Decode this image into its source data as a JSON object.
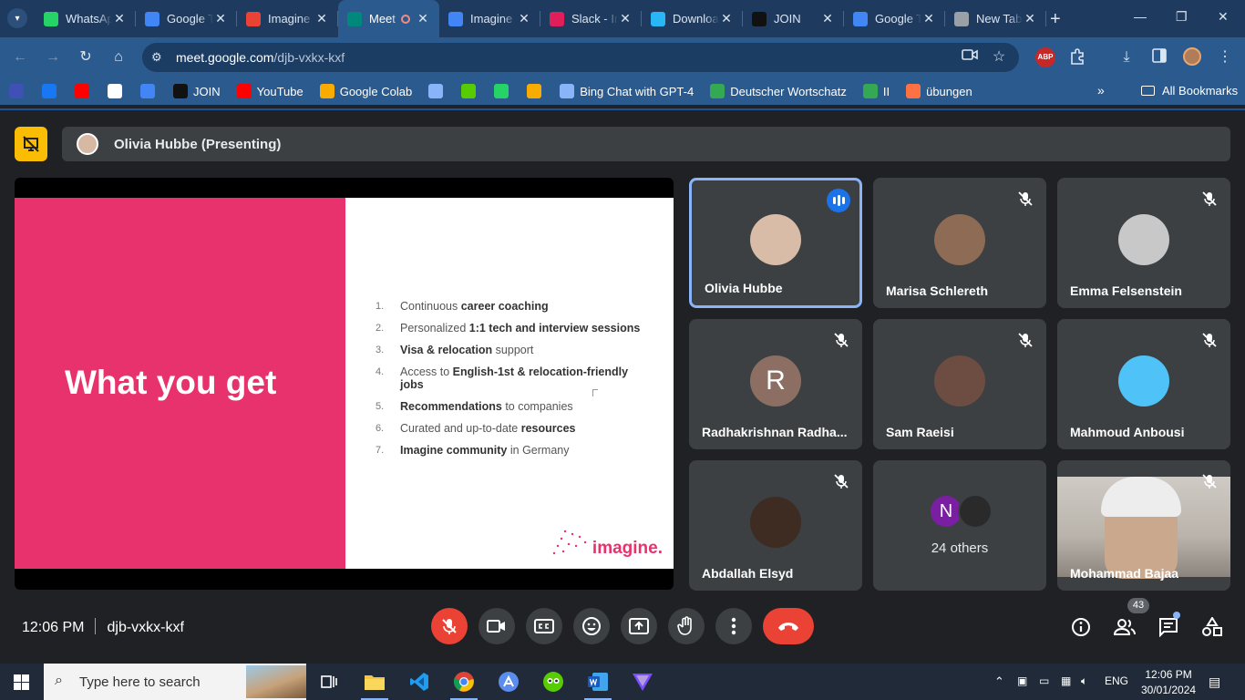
{
  "browser": {
    "tabs": [
      {
        "title": "WhatsApp",
        "favicon": "whatsapp-icon",
        "color": "#25d366"
      },
      {
        "title": "Google Translate",
        "favicon": "google-translate-icon",
        "color": "#4285f4"
      },
      {
        "title": "Imagine",
        "favicon": "gmail-icon",
        "color": "#ea4335"
      },
      {
        "title": "Meet",
        "favicon": "google-meet-icon",
        "color": "#00897b",
        "active": true,
        "recording": true
      },
      {
        "title": "Imagine",
        "favicon": "google-docs-icon",
        "color": "#4285f4"
      },
      {
        "title": "Slack - Imagine",
        "favicon": "slack-icon",
        "color": "#e01e5a"
      },
      {
        "title": "Download",
        "favicon": "download-site-icon",
        "color": "#29b6f6"
      },
      {
        "title": "JOIN",
        "favicon": "join-icon",
        "color": "#111111"
      },
      {
        "title": "Google Translate",
        "favicon": "google-translate-icon",
        "color": "#4285f4"
      },
      {
        "title": "New Tab",
        "favicon": "chrome-icon",
        "color": "#9aa0a6"
      }
    ],
    "url_host": "meet.google.com",
    "url_path": "/djb-vxkx-kxf",
    "bookmarks": [
      {
        "label": "",
        "icon": "extension-icon",
        "color": "#3f51b5"
      },
      {
        "label": "",
        "icon": "facebook-icon",
        "color": "#1877f2"
      },
      {
        "label": "",
        "icon": "youtube-icon",
        "color": "#ff0000"
      },
      {
        "label": "",
        "icon": "google-icon",
        "color": "#ffffff"
      },
      {
        "label": "",
        "icon": "google-translate-icon",
        "color": "#4285f4"
      },
      {
        "label": "JOIN",
        "icon": "join-icon",
        "color": "#111111"
      },
      {
        "label": "YouTube",
        "icon": "youtube-icon",
        "color": "#ff0000"
      },
      {
        "label": "Google Colab",
        "icon": "colab-icon",
        "color": "#f9ab00"
      },
      {
        "label": "",
        "icon": "image-icon",
        "color": "#8ab4f8"
      },
      {
        "label": "",
        "icon": "duolingo-icon",
        "color": "#58cc02"
      },
      {
        "label": "",
        "icon": "whatsapp-icon",
        "color": "#25d366"
      },
      {
        "label": "",
        "icon": "number-five-icon",
        "color": "#f9ab00"
      },
      {
        "label": "Bing Chat with GPT-4",
        "icon": "search-icon",
        "color": "#8ab4f8"
      },
      {
        "label": "Deutscher Wortschatz",
        "icon": "plus-icon",
        "color": "#34a853"
      },
      {
        "label": "II",
        "icon": "plus-icon",
        "color": "#34a853"
      },
      {
        "label": "übungen",
        "icon": "leaf-icon",
        "color": "#ff7043"
      }
    ],
    "all_bookmarks": "All Bookmarks"
  },
  "meet": {
    "presenting_label": "Olivia Hubbe (Presenting)",
    "slide": {
      "title": "What you get",
      "items": [
        {
          "num": "1.",
          "parts": [
            {
              "t": "Continuous ",
              "b": false
            },
            {
              "t": "career coaching",
              "b": true
            }
          ]
        },
        {
          "num": "2.",
          "parts": [
            {
              "t": "Personalized ",
              "b": false
            },
            {
              "t": "1:1 tech and interview sessions",
              "b": true
            }
          ]
        },
        {
          "num": "3.",
          "parts": [
            {
              "t": "Visa & relocation",
              "b": true
            },
            {
              "t": " support",
              "b": false
            }
          ]
        },
        {
          "num": "4.",
          "parts": [
            {
              "t": "Access to ",
              "b": false
            },
            {
              "t": "English-1st & relocation-friendly jobs",
              "b": true
            }
          ]
        },
        {
          "num": "5.",
          "parts": [
            {
              "t": "Recommendations",
              "b": true
            },
            {
              "t": " to companies",
              "b": false
            }
          ]
        },
        {
          "num": "6.",
          "parts": [
            {
              "t": "Curated and up-to-date ",
              "b": false
            },
            {
              "t": "resources",
              "b": true
            }
          ]
        },
        {
          "num": "7.",
          "parts": [
            {
              "t": "Imagine community",
              "b": true
            },
            {
              "t": " in Germany",
              "b": false
            }
          ]
        }
      ],
      "logo_text": "imagine.",
      "accent_color": "#e8326e"
    },
    "participants": [
      {
        "name": "Olivia Hubbe",
        "initial": "",
        "avatar_color": "#d9bca8",
        "speaking": true
      },
      {
        "name": "Marisa Schlereth",
        "initial": "",
        "avatar_color": "#8d6b54",
        "muted": true
      },
      {
        "name": "Emma Felsenstein",
        "initial": "",
        "avatar_color": "#c8c8c8",
        "muted": true
      },
      {
        "name": "Radhakrishnan Radha...",
        "initial": "R",
        "avatar_color": "#8d6e63",
        "muted": true
      },
      {
        "name": "Sam Raeisi",
        "initial": "",
        "avatar_color": "#6d4c41",
        "muted": true
      },
      {
        "name": "Mahmoud Anbousi",
        "initial": "",
        "avatar_color": "#4fc3f7",
        "muted": true
      },
      {
        "name": "Abdallah Elsyd",
        "initial": "",
        "avatar_color": "#3e2b22",
        "muted": true
      }
    ],
    "others": {
      "initial": "N",
      "label": "24 others"
    },
    "video_participant": {
      "name": "Mohammad Bajaa"
    },
    "time": "12:06 PM",
    "code": "djb-vxkx-kxf",
    "people_count": "43"
  },
  "taskbar": {
    "search_placeholder": "Type here to search",
    "language": "ENG",
    "time": "12:06 PM",
    "date": "30/01/2024"
  }
}
